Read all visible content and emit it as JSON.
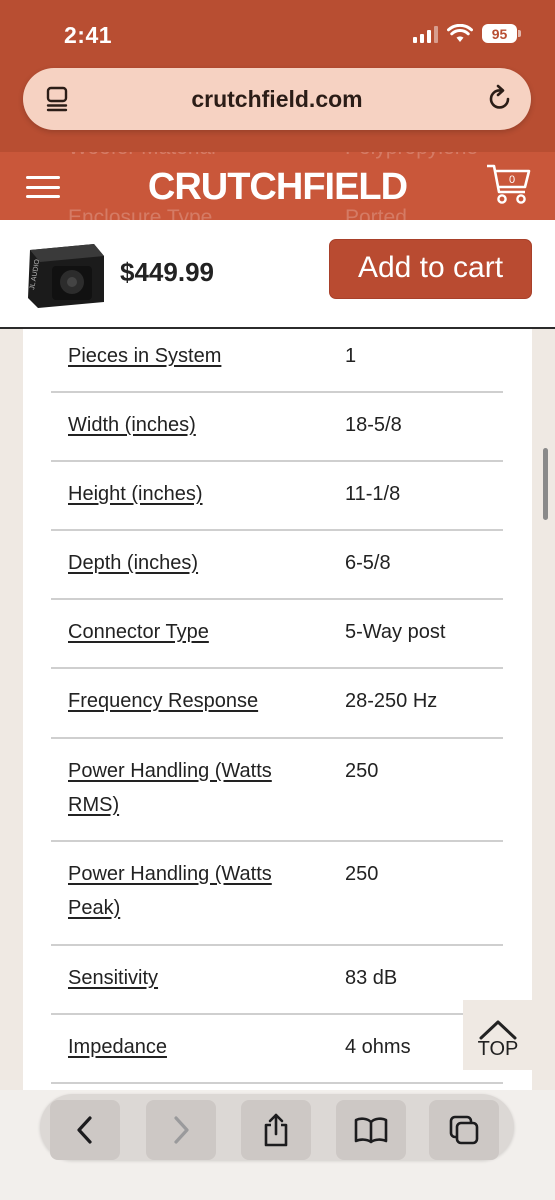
{
  "status_bar": {
    "time": "2:41",
    "battery": "95"
  },
  "browser": {
    "url": "crutchfield.com"
  },
  "site": {
    "logo": "CRUTCHFIELD",
    "cart_count": "0",
    "ghost_rows": [
      {
        "label": "Woofer Material",
        "value": "Polypropylene"
      },
      {
        "label": "Enclosure Type",
        "value": "Ported"
      }
    ]
  },
  "product": {
    "price": "$449.99",
    "add_to_cart_label": "Add to cart",
    "thumb_brand": "JL AUDIO"
  },
  "specs": [
    {
      "label": "Pieces in System",
      "value": "1"
    },
    {
      "label": "Width (inches)",
      "value": "18-5/8"
    },
    {
      "label": "Height (inches)",
      "value": "11-1/8"
    },
    {
      "label": "Depth (inches)",
      "value": "6-5/8"
    },
    {
      "label": "Connector Type",
      "value": "5-Way post"
    },
    {
      "label": "Frequency Response",
      "value": "28-250 Hz"
    },
    {
      "label": "Power Handling (Watts RMS)",
      "value": "250"
    },
    {
      "label": "Power Handling (Watts Peak)",
      "value": "250"
    },
    {
      "label": "Sensitivity",
      "value": "83 dB"
    },
    {
      "label": "Impedance",
      "value": "4 ohms"
    }
  ],
  "top_button_label": "TOP",
  "toolbar": {
    "icons": [
      "back-icon",
      "forward-icon",
      "share-icon",
      "bookmarks-icon",
      "tabs-icon"
    ]
  }
}
